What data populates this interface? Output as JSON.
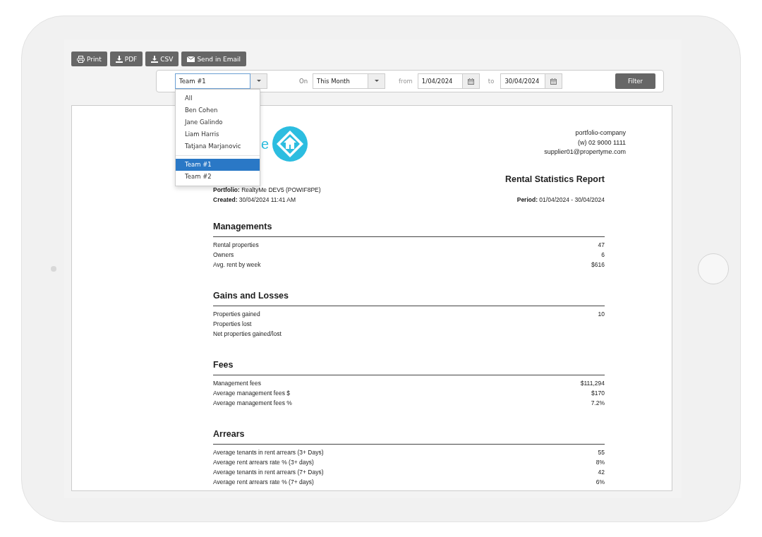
{
  "toolbar": {
    "buttons": [
      {
        "label": "Print",
        "kind": "print"
      },
      {
        "label": "PDF",
        "kind": "download"
      },
      {
        "label": "CSV",
        "kind": "download"
      },
      {
        "label": "Send in Email",
        "kind": "mail"
      }
    ]
  },
  "filter": {
    "team_value": "Team #1",
    "on_label": "On",
    "period_value": "This Month",
    "from_label": "from",
    "from_value": "1/04/2024",
    "to_label": "to",
    "to_value": "30/04/2024",
    "button": "Filter"
  },
  "dropdown": {
    "groups": [
      {
        "items": [
          {
            "label": "All",
            "selected": false
          },
          {
            "label": "Ben Cohen",
            "selected": false
          },
          {
            "label": "Jane Galindo",
            "selected": false
          },
          {
            "label": "Liam Harris",
            "selected": false
          },
          {
            "label": "Tatjana Marjanovic",
            "selected": false
          }
        ]
      },
      {
        "items": [
          {
            "label": "Team #1",
            "selected": true
          },
          {
            "label": "Team #2",
            "selected": false
          }
        ]
      }
    ]
  },
  "report": {
    "logo_text": "e",
    "company": [
      "portfolio-company",
      "(w) 02 9000 1111",
      "supplier01@propertyme.com"
    ],
    "title": "Rental Statistics Report",
    "portfolio": "**Portfolio:** RealtyMe DEV5 (POWIF8PE)",
    "created": "**Created:** 30/04/2024 11:41 AM",
    "period": "**Period:** 01/04/2024 - 30/04/2024",
    "sections": [
      {
        "title": "Managements",
        "rows": [
          {
            "label": "Rental properties",
            "value": "47"
          },
          {
            "label": "Owners",
            "value": "6"
          },
          {
            "label": "Avg. rent by week",
            "value": "$616"
          }
        ]
      },
      {
        "title": "Gains and Losses",
        "rows": [
          {
            "label": "Properties gained",
            "value": "10"
          },
          {
            "label": "Properties lost"
          },
          {
            "label": "Net properties gained/lost"
          }
        ]
      },
      {
        "title": "Fees",
        "rows": [
          {
            "label": "Management fees",
            "value": "$111,294"
          },
          {
            "label": "Average management fees $",
            "value": "$170"
          },
          {
            "label": "Average management fees %",
            "value": "7.2%"
          }
        ]
      },
      {
        "title": "Arrears",
        "rows": [
          {
            "label": "Average tenants in rent arrears (3+ Days)",
            "value": "55"
          },
          {
            "label": "Average rent arrears rate % (3+ days)",
            "value": "8%"
          },
          {
            "label": "Average tenants in rent arrears (7+ Days)",
            "value": "42"
          },
          {
            "label": "Average rent arrears rate % (7+ days)",
            "value": "6%"
          }
        ]
      }
    ]
  }
}
